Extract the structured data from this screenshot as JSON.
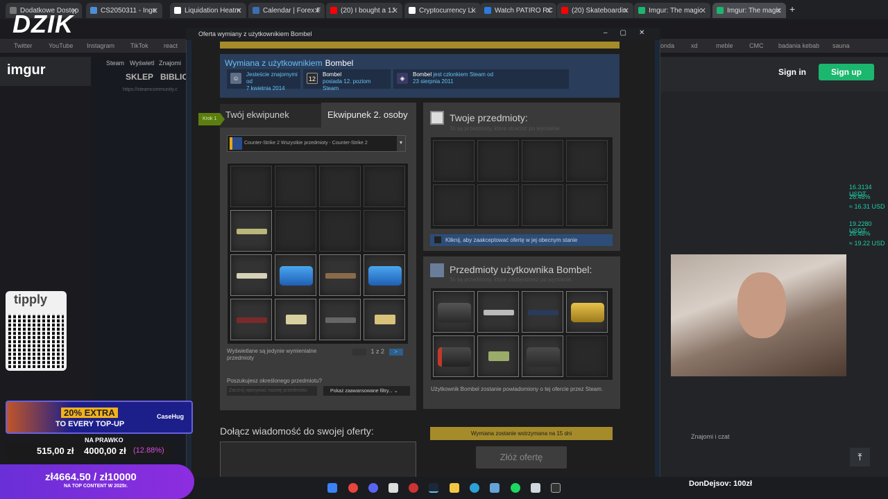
{
  "browser": {
    "tabs": [
      {
        "label": "Dodatkowe Dostęp",
        "color": "#777"
      },
      {
        "label": "CS2050311 - Inge",
        "color": "#4a90d9"
      },
      {
        "label": "Liquidation Heatm",
        "color": "#ffffff"
      },
      {
        "label": "Calendar | Forex F",
        "color": "#3a6fb5"
      },
      {
        "label": "(20) I bought a 1J",
        "color": "#ff0000"
      },
      {
        "label": "Cryptocurrency Li",
        "color": "#ffffff"
      },
      {
        "label": "Watch PATIRO RC",
        "color": "#2a7dde"
      },
      {
        "label": "(20) Skateboardin",
        "color": "#ff0000"
      },
      {
        "label": "Imgur: The magic",
        "color": "#1bb76e"
      },
      {
        "label": "Imgur: The magic",
        "color": "#1bb76e"
      }
    ],
    "new_tab": "+",
    "bookmarks": [
      "Twitter",
      "YouTube",
      "Instagram",
      "TikTok",
      "react",
      "onda",
      "xd",
      "meble",
      "CMC",
      "badania kebab",
      "sauna"
    ]
  },
  "overlay": {
    "brand": "DZIK",
    "tipply": "tipply",
    "tipply_url": "https://tipply.pl/@patiro",
    "promo_line1": "20% EXTRA",
    "promo_line2": "TO EVERY TOP-UP",
    "casehug": "CaseHug",
    "goal_label": "NA PRAWKO",
    "goal_current": "515,00 zł",
    "goal_target": "4000,00 zł",
    "goal_percent": "(12.88%)",
    "goal2_text": "zł4664.50 / zł10000",
    "goal2_sub": "NA TOP CONTENT W 2025r.",
    "donation": "DonDejsov: 100zł"
  },
  "imgur": {
    "logo": "imgur",
    "sign_in": "Sign in",
    "sign_up": "Sign up"
  },
  "steam_side": {
    "label": "Steam",
    "menu": [
      "Wyświetl",
      "Znajomi"
    ],
    "nav": [
      "SKLEP",
      "BIBLIO"
    ],
    "url": "https://steamcommunity.c"
  },
  "crypto": [
    "16.3134 USDT",
    "26.48%",
    "≈ 16.31 USD",
    "19.2280 USDT",
    "26.48%",
    "≈ 19.22 USD"
  ],
  "dialog": {
    "title": "Oferta wymiany z użytkownikiem Bombel",
    "partner_heading": "Wymiana z użytkownikiem",
    "partner_name": "Bombel",
    "friends_since": "Jesteście znajomymi od",
    "friends_date": "7 kwietnia 2014",
    "level_badge": "12",
    "level_text_name": "Bombel",
    "level_text": "posiada 12. poziom Steam",
    "member_name": "Bombel",
    "member_text": "jest członkiem Steam od",
    "member_date": "23 sierpnia 2011",
    "tab_mine": "Twój ekwipunek",
    "tab_theirs": "Ekwipunek 2. osoby",
    "step": "Krok 1",
    "game_select": "Counter-Strike 2 Wszystkie przedmioty - Counter-Strike 2",
    "shown_note": "Wyświetlane są jedynie wymienialne przedmioty",
    "pager": "1 z 2",
    "pager_next": ">",
    "search_question": "Poszukujesz określonego przedmiotu?",
    "search_placeholder": "Zacznij wpisywać nazwę przedmiotu",
    "filters": "Pokaż zaawansowane filtry...",
    "message_heading": "Dołącz wiadomość do swojej oferty:",
    "your_items": "Twoje przedmioty:",
    "your_items_sub": "To są przedmioty, które utracisz po wymianie.",
    "accept_check": "Kliknij, aby zaakceptować ofertę w jej obecnym stanie",
    "their_items": "Przedmioty użytkownika Bombel:",
    "their_items_sub": "To są przedmioty, które zdobędziesz po wymianie.",
    "notify": "Użytkownik Bombel zostanie powiadomiony o tej ofercie przez Steam.",
    "hold": "Wymiana zostanie wstrzymana na 15 dni",
    "submit": "Złóż ofertę"
  },
  "inventory": [
    "",
    "",
    "",
    "",
    "rifle-famas",
    "",
    "",
    "",
    "rifle-m4",
    "case-blue",
    "sniper",
    "case-blue",
    "rifle-ak",
    "pistol-deagle",
    "smg",
    "pistol-gold"
  ],
  "their_inventory": [
    "case-dark",
    "rifle-scope",
    "rifle-blue",
    "case-gold",
    "case-red",
    "pistol-green",
    "case-dark2",
    ""
  ],
  "friends_chat": "Znajomi i czat"
}
